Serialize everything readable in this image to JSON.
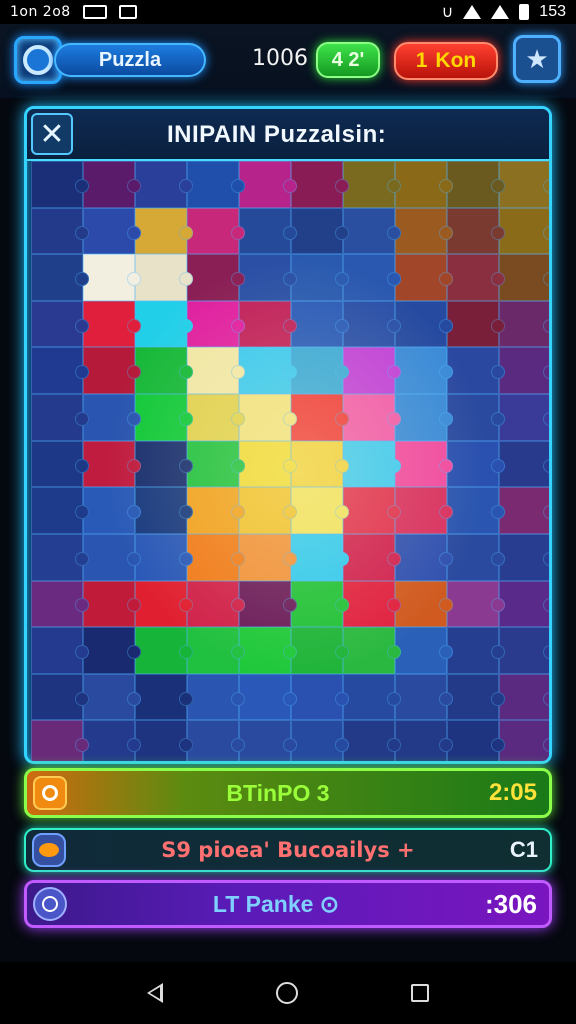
{
  "status_bar": {
    "time": "1on 2o8",
    "right_value": "153"
  },
  "top_bar": {
    "title": "Puzzla",
    "score": "1006",
    "green_badge": "4 2'",
    "red_badge_num": "1",
    "red_badge_label": "Kon",
    "star_icon": "star-icon",
    "left_icon": "refresh-icon"
  },
  "board": {
    "title": "INIPAIN Puzzalsin:",
    "close_label": "✕",
    "grid": {
      "columns": 10,
      "rows": 13,
      "cells": [
        "#1a2f78",
        "#5a1b6a",
        "#2a3f9a",
        "#1f4faa",
        "#b6238a",
        "#8a1c55",
        "#7a6a20",
        "#8a6a18",
        "#6a5a20",
        "#8a7020",
        "#233a8a",
        "#2c4aaa",
        "#d6a836",
        "#c7287a",
        "#254a9a",
        "#223f8a",
        "#2a4fa0",
        "#9a5a20",
        "#7a3a30",
        "#8a6b1a",
        "#1f3f8a",
        "#f2efe0",
        "#e8e3c8",
        "#8a1f55",
        "#2a4fa5",
        "#2a5ab0",
        "#2a58b0",
        "#a2462a",
        "#8a2f40",
        "#7a4a20",
        "#2a3a90",
        "#e01f3c",
        "#22cfe8",
        "#e020a0",
        "#c0205a",
        "#2a5ab8",
        "#2a4fa8",
        "#264aa0",
        "#7a1f3a",
        "#6a2a6a",
        "#1f3a90",
        "#b51a3a",
        "#17b83a",
        "#f0e6a6",
        "#3ac8f0",
        "#3aa8d8",
        "#c040d8",
        "#3a8ad8",
        "#2a48a0",
        "#5a2a80",
        "#243a8c",
        "#2a55b0",
        "#12c83a",
        "#e0d050",
        "#f0e080",
        "#ee3a3a",
        "#f05aaa",
        "#3a8ad8",
        "#2a4aa0",
        "#3a3a98",
        "#1c3886",
        "#c01c40",
        "#1a2f70",
        "#20c040",
        "#f0d838",
        "#f0d040",
        "#40c8f0",
        "#f04aa0",
        "#2a50b0",
        "#283a8c",
        "#1e3a8a",
        "#2a5ab8",
        "#1a3a80",
        "#f0a020",
        "#f0c030",
        "#f0e060",
        "#e03050",
        "#d83060",
        "#2a55b0",
        "#7a2a70",
        "#243e92",
        "#2a55b0",
        "#2a58b8",
        "#f07a1a",
        "#f0903a",
        "#30c8f0",
        "#d02050",
        "#3050b0",
        "#2a4aa0",
        "#283c90",
        "#6a2a80",
        "#c01c3a",
        "#e01f30",
        "#d0204a",
        "#6a1a5a",
        "#20c038",
        "#e02040",
        "#d05a20",
        "#8a3a90",
        "#5a2a8a",
        "#243a8e",
        "#1a2a70",
        "#17b43a",
        "#20c040",
        "#1fc83a",
        "#1fb43a",
        "#2ab840",
        "#2a60b8",
        "#263e90",
        "#2a3a8c",
        "#1f3480",
        "#2a4aa0",
        "#1a3078",
        "#2a55b0",
        "#2a58b8",
        "#2a50b0",
        "#264aa0",
        "#2a4aa0",
        "#223a88",
        "#5a2a80",
        "#6a2a7a",
        "#243a8c",
        "#1f3480",
        "#2a4aa0",
        "#2a4aa0",
        "#264aa0",
        "#223a88",
        "#223a88",
        "#1f3480",
        "#5a2a80"
      ]
    }
  },
  "rows": [
    {
      "label": "BTinPO 3",
      "value": "2:05",
      "icon": "coin-icon"
    },
    {
      "label": "S9 pioea' Bucoailys +",
      "value": "C1",
      "icon": "pie-icon"
    },
    {
      "label": "LT Panke ⊙",
      "value": ":306",
      "icon": "compass-icon"
    }
  ],
  "nav": {
    "back_icon": "back-icon",
    "home_icon": "home-icon",
    "recent_icon": "recent-icon"
  }
}
